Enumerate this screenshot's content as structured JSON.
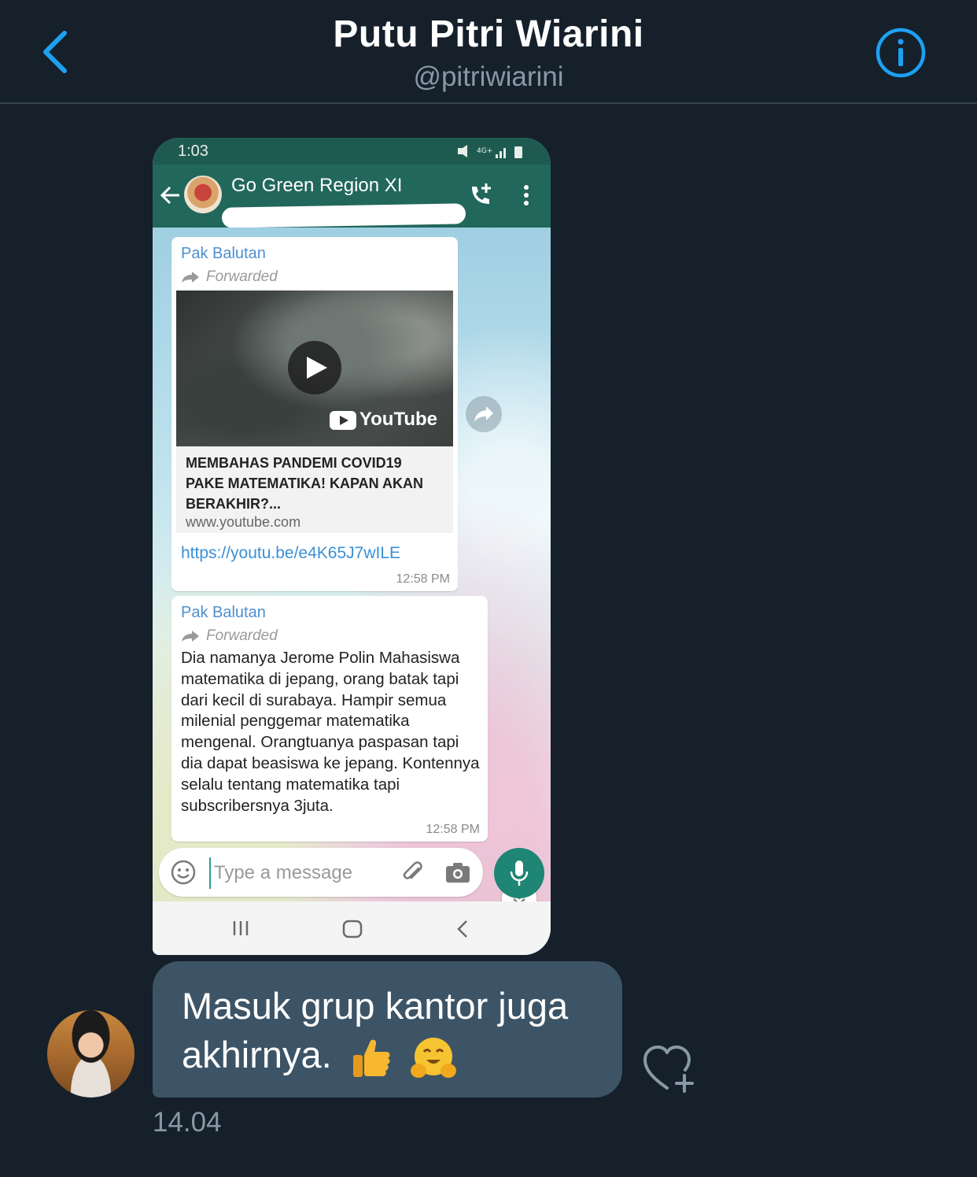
{
  "header": {
    "name": "Putu Pitri Wiarini",
    "handle": "@pitriwiarini",
    "back_icon": "chevron-left-icon",
    "info_icon": "info-circle-icon",
    "accent_color": "#1da1f2"
  },
  "shared_image": {
    "status_bar": {
      "time": "1:03"
    },
    "app_bar": {
      "group_name": "Go Green Region XI"
    },
    "messages": [
      {
        "sender": "Pak Balutan",
        "forwarded_label": "Forwarded",
        "video_platform": "YouTube",
        "preview_title": "MEMBAHAS PANDEMI COVID19 PAKE MATEMATIKA! KAPAN AKAN BERAKHIR?...",
        "preview_domain": "www.youtube.com",
        "link": "https://youtu.be/e4K65J7wILE",
        "time": "12:58 PM"
      },
      {
        "sender": "Pak Balutan",
        "forwarded_label": "Forwarded",
        "text": "Dia namanya Jerome Polin Mahasiswa matematika di jepang, orang batak tapi dari kecil di surabaya. Hampir semua milenial penggemar matematika mengenal. Orangtuanya paspasan tapi dia dapat beasiswa ke jepang. Kontennya selalu tentang matematika tapi subscribersnya 3juta.",
        "time": "12:58 PM"
      }
    ],
    "input_placeholder": "Type a message",
    "whatsapp_green": "#22675b"
  },
  "dm_message": {
    "text": "Masuk grup kantor juga akhirnya.",
    "emojis": [
      "thumbs-up",
      "hugging-face"
    ],
    "time": "14.04"
  }
}
